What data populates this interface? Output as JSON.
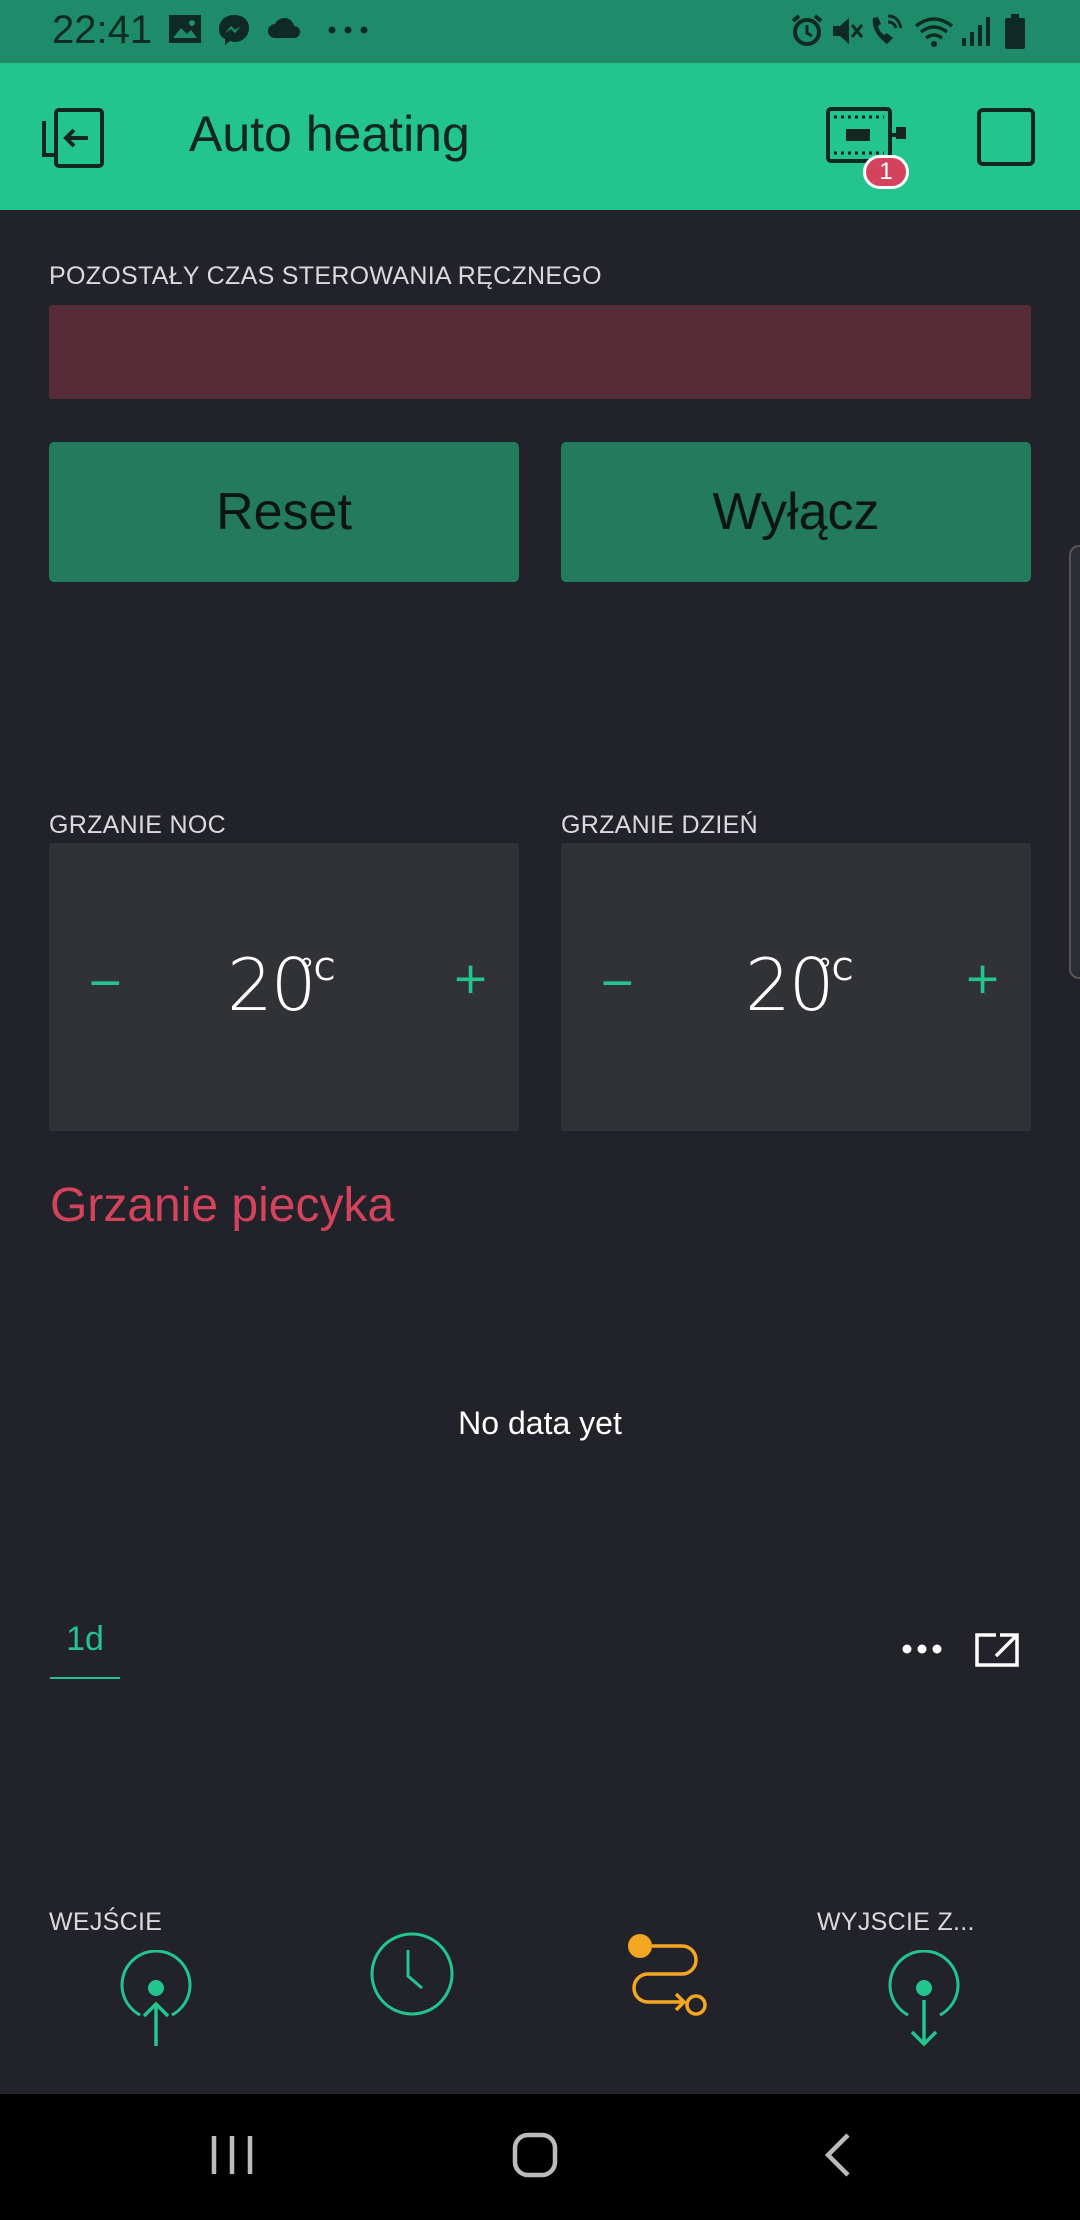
{
  "status_bar": {
    "time": "22:41",
    "left_icons": [
      "gallery-icon",
      "messenger-icon",
      "cloud-icon",
      "more-dots-icon"
    ],
    "right_icons": [
      "alarm-icon",
      "mute-icon",
      "wifi-call-icon",
      "wifi-icon",
      "signal-icon",
      "battery-icon"
    ]
  },
  "app_bar": {
    "title": "Auto heating",
    "device_badge_count": "1",
    "icons": [
      "exit-icon",
      "device-icon",
      "stop-icon"
    ]
  },
  "manual_control": {
    "label": "POZOSTAŁY CZAS STEROWANIA RĘCZNEGO",
    "value": ""
  },
  "buttons": {
    "reset": "Reset",
    "off": "Wyłącz"
  },
  "night_heating": {
    "label": "GRZANIE NOC",
    "minus": "−",
    "plus": "+",
    "value": "20",
    "unit": "°C"
  },
  "day_heating": {
    "label": "GRZANIE DZIEŃ",
    "minus": "−",
    "plus": "+",
    "value": "20",
    "unit": "°C"
  },
  "chart": {
    "title": "Grzanie piecyka",
    "empty_text": "No data yet",
    "range_tab": "1d"
  },
  "bottom_widgets": {
    "input_label": "WEJŚCIE",
    "output_label": "WYJSCIE Z..."
  },
  "colors": {
    "accent": "#23c48e",
    "background": "#22232a",
    "chart_title": "#d3435c",
    "eventor": "#f5a623"
  }
}
